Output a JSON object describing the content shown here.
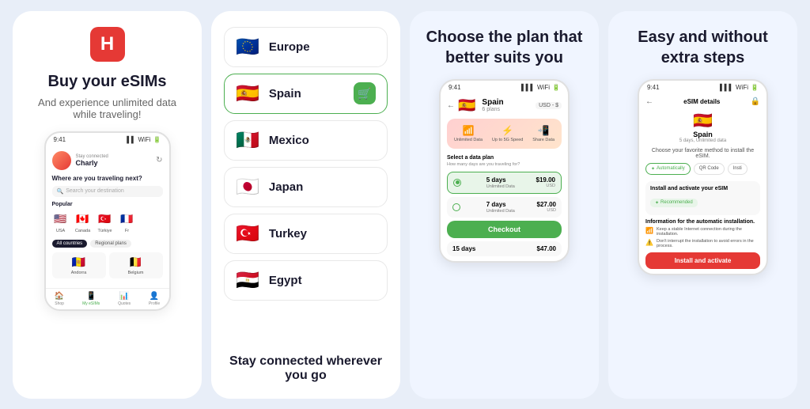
{
  "panel1": {
    "title": "Buy your eSIMs",
    "subtitle": "And experience unlimited data while traveling!",
    "phone": {
      "time": "9:41",
      "connected": "Stay connected",
      "user": "Charly",
      "question": "Where are you traveling next?",
      "search_placeholder": "Search your destination",
      "popular_label": "Popular",
      "flags": [
        {
          "emoji": "🇺🇸",
          "label": "USA"
        },
        {
          "emoji": "🇨🇦",
          "label": "Canada"
        },
        {
          "emoji": "🇹🇷",
          "label": "Türkiye"
        },
        {
          "emoji": "🇫🇷",
          "label": "Fr"
        }
      ],
      "tabs": [
        "All countries",
        "Regional plans"
      ],
      "countries": [
        {
          "emoji": "🇦🇩",
          "name": "Andorra"
        },
        {
          "emoji": "🇧🇪",
          "name": "Belgium"
        }
      ],
      "nav_items": [
        "Shop",
        "My eSIMs",
        "Quotes",
        "Profile"
      ]
    }
  },
  "panel2": {
    "countries": [
      {
        "emoji": "🇪🇺",
        "name": "Europe",
        "selected": false
      },
      {
        "emoji": "🇪🇸",
        "name": "Spain",
        "selected": true
      },
      {
        "emoji": "🇲🇽",
        "name": "Mexico",
        "selected": false
      },
      {
        "emoji": "🇯🇵",
        "name": "Japan",
        "selected": false
      },
      {
        "emoji": "🇹🇷",
        "name": "Turkey",
        "selected": false
      },
      {
        "emoji": "🇪🇬",
        "name": "Egypt",
        "selected": false
      }
    ],
    "bottom_text": "Stay connected wherever you go"
  },
  "panel3": {
    "title": "Choose the plan that better suits you",
    "phone": {
      "time": "9:41",
      "country_flag": "🇪🇸",
      "country_name": "Spain",
      "plans_count": "6 plans",
      "currency": "USD - $",
      "features": [
        {
          "icon": "📶",
          "label": "Unlimited Data"
        },
        {
          "icon": "⚡",
          "label": "Up to 5G Speed"
        },
        {
          "icon": "📲",
          "label": "Share Data"
        }
      ],
      "select_label": "Select a data plan",
      "select_sub": "How many days are you traveling for?",
      "plans": [
        {
          "days": "5 days",
          "data": "Unlimited Data",
          "price": "$19.00",
          "currency": "USD",
          "selected": true
        },
        {
          "days": "7 days",
          "data": "Unlimited Data",
          "price": "$27.00",
          "currency": "USD",
          "selected": false
        },
        {
          "days": "15 days",
          "data": "",
          "price": "$47.00",
          "currency": "",
          "selected": false
        }
      ],
      "checkout_label": "Checkout"
    }
  },
  "panel4": {
    "title": "Easy and without extra steps",
    "phone": {
      "time": "9:41",
      "screen_title": "eSIM details",
      "country_flag": "🇪🇸",
      "country_name": "Spain",
      "plan_desc": "5 days, Unlimited data",
      "install_label": "Choose your favorite method to install the eSIM.",
      "methods": [
        "Automatically",
        "QR Code",
        "Insti"
      ],
      "step_title": "Install and activate your eSIM",
      "recommended": "Recommended",
      "info_title": "Information for the automatic installation.",
      "info_items": [
        "Keep a stable Internet connection during the installation.",
        "Don't interrupt the installation to avoid errors in the process."
      ],
      "install_btn": "Install and activate"
    }
  }
}
